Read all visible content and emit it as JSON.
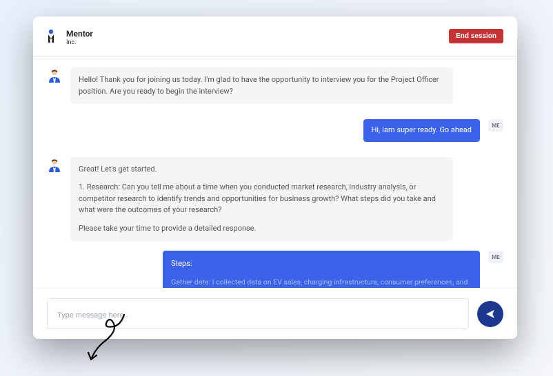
{
  "brand": {
    "name": "Mentor",
    "sub": "Inc."
  },
  "header": {
    "end_label": "End session"
  },
  "me_badge": "ME",
  "messages": {
    "bot1": "Hello! Thank you for joining us today. I'm glad to have the opportunity to interview you for the Project Officer position. Are you ready to begin the interview?",
    "user1": "Hi, Iam super ready. Go ahead",
    "bot2_p1": "Great! Let's get started.",
    "bot2_p2": "1. Research: Can you tell me about a time when you conducted market research, industry analysis, or competitor research to identify trends and opportunities for business growth? What steps did you take and what were the outcomes of your research?",
    "bot2_p3": "Please take your time to provide a detailed response.",
    "user2_title": "Steps:",
    "user2_body": "Gather data: I collected data on EV sales, charging infrastructure, consumer preferences, and government policies"
  },
  "composer": {
    "placeholder": "Type message here.."
  }
}
